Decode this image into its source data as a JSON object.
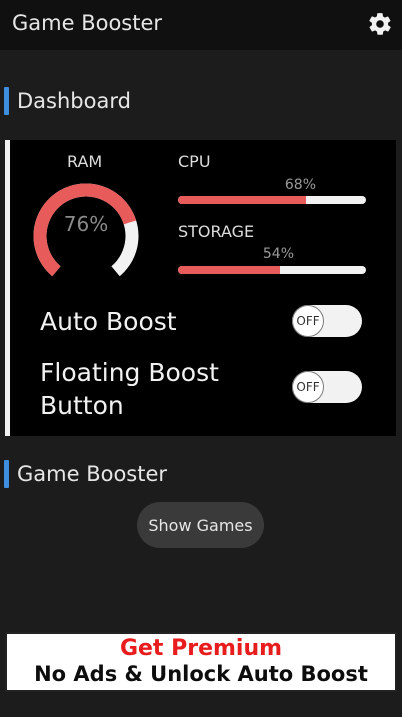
{
  "appbar": {
    "title": "Game Booster",
    "settings_icon": "gear-icon"
  },
  "dashboard": {
    "section_title": "Dashboard",
    "ram": {
      "label": "RAM",
      "value_text": "76%",
      "percent": 76
    },
    "cpu": {
      "label": "CPU",
      "value_text": "68%",
      "percent": 68
    },
    "storage": {
      "label": "STORAGE",
      "value_text": "54%",
      "percent": 54
    },
    "auto_boost": {
      "label": "Auto Boost",
      "state": "OFF"
    },
    "floating_boost": {
      "label_line1": "Floating Boost",
      "label_line2": "Button",
      "state": "OFF"
    }
  },
  "booster": {
    "section_title": "Game Booster",
    "show_games_label": "Show Games"
  },
  "premium": {
    "title": "Get Premium",
    "subtitle": "No Ads & Unlock Auto Boost"
  },
  "colors": {
    "accent": "#3f8fe0",
    "meter_fill": "#e85b5b",
    "premium_red": "#e81c1c"
  }
}
